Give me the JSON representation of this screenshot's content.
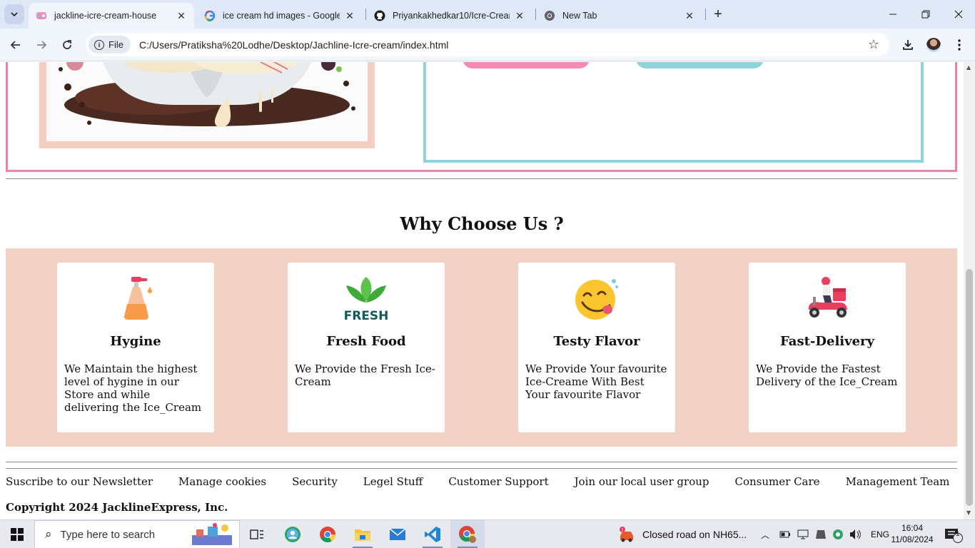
{
  "browser": {
    "tabs": [
      {
        "title": "jackline-icre-cream-house",
        "active": true
      },
      {
        "title": "ice cream hd images - Google S",
        "active": false
      },
      {
        "title": "Priyankakhedkar10/Icre-Cream",
        "active": false
      },
      {
        "title": "New Tab",
        "active": false
      }
    ],
    "address": {
      "chip_label": "File",
      "url": "C:/Users/Pratiksha%20Lodhe/Desktop/Jachline-Icre-cream/index.html"
    }
  },
  "page": {
    "section_title": "Why Choose Us ?",
    "features": [
      {
        "icon": "hygiene-soap-icon",
        "title": "Hygine",
        "text": "We Maintain the highest level of hygine in our Store and while delivering the Ice_Cream"
      },
      {
        "icon": "fresh-leaf-icon",
        "title": "Fresh Food",
        "icon_text": "FRESH",
        "text": "We Provide the Fresh Ice-Cream"
      },
      {
        "icon": "yummy-face-icon",
        "title": "Testy Flavor",
        "text": "We Provide Your favourite Ice-Creame With Best Your favourite Flavor"
      },
      {
        "icon": "delivery-scooter-icon",
        "title": "Fast-Delivery",
        "text": "We Provide the Fastest Delivery of the Ice_Cream"
      }
    ],
    "footer_links": [
      "Suscribe to our Newsletter",
      "Manage cookies",
      "Security",
      "Legel Stuff",
      "Customer Support",
      "Join our local user group",
      "Consumer Care",
      "Management Team"
    ],
    "copyright": "Copyright 2024 JacklineExpress, Inc."
  },
  "taskbar": {
    "search_placeholder": "Type here to search",
    "notification": "Closed road on NH65...",
    "language": "ENG",
    "time": "16:04",
    "date": "11/08/2024",
    "notification_count": "1"
  },
  "colors": {
    "hero_border_pink": "#e984ac",
    "hero_border_teal": "#8fd3dc",
    "features_background": "#f2d2c5"
  }
}
